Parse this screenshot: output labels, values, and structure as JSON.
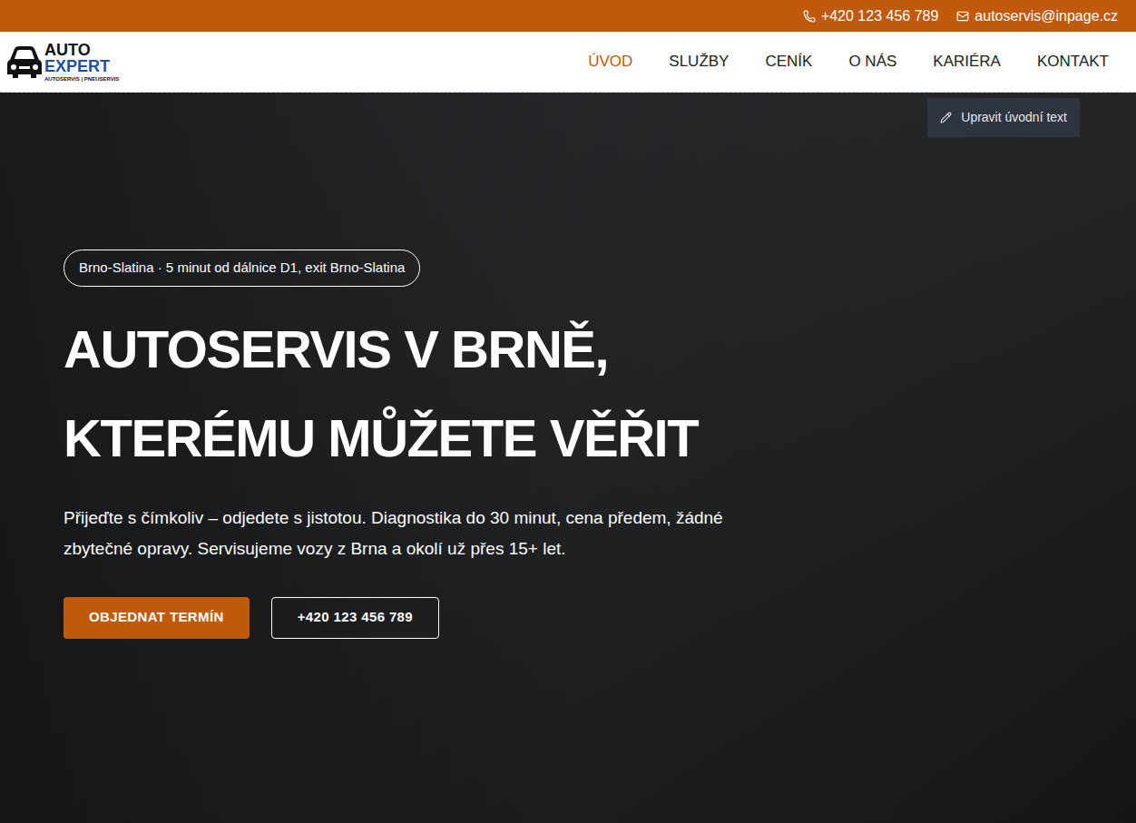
{
  "topbar": {
    "phone": "+420 123 456 789",
    "email": "autoservis@inpage.cz"
  },
  "logo": {
    "line1": "AUTO",
    "line2": "EXPERT",
    "tagline": "AUTOSERVIS | PNEUSERVIS"
  },
  "nav": [
    {
      "label": "ÚVOD",
      "selected": true
    },
    {
      "label": "SLUŽBY",
      "selected": false
    },
    {
      "label": "CENÍK",
      "selected": false
    },
    {
      "label": "O NÁS",
      "selected": false
    },
    {
      "label": "KARIÉRA",
      "selected": false
    },
    {
      "label": "KONTAKT",
      "selected": false
    }
  ],
  "edit_button": "Upravit úvodní text",
  "hero": {
    "badge": "Brno-Slatina · 5 minut od dálnice D1, exit Brno-Slatina",
    "heading": [
      "AUTOSERVIS V BRNĚ,",
      "KTERÉMU MŮŽETE VĚŘIT"
    ],
    "text": "Přijeďte s čímkoliv – odjedete s jistotou. Diagnostika do 30 minut, cena předem, žádné zbytečné opravy. Servisujeme vozy z Brna a okolí už přes 15+ let.",
    "buttons": [
      {
        "label": "OBJEDNAT TERMÍN",
        "kind": "primary"
      },
      {
        "label": "+420 123 456 789",
        "kind": "outline"
      }
    ]
  }
}
